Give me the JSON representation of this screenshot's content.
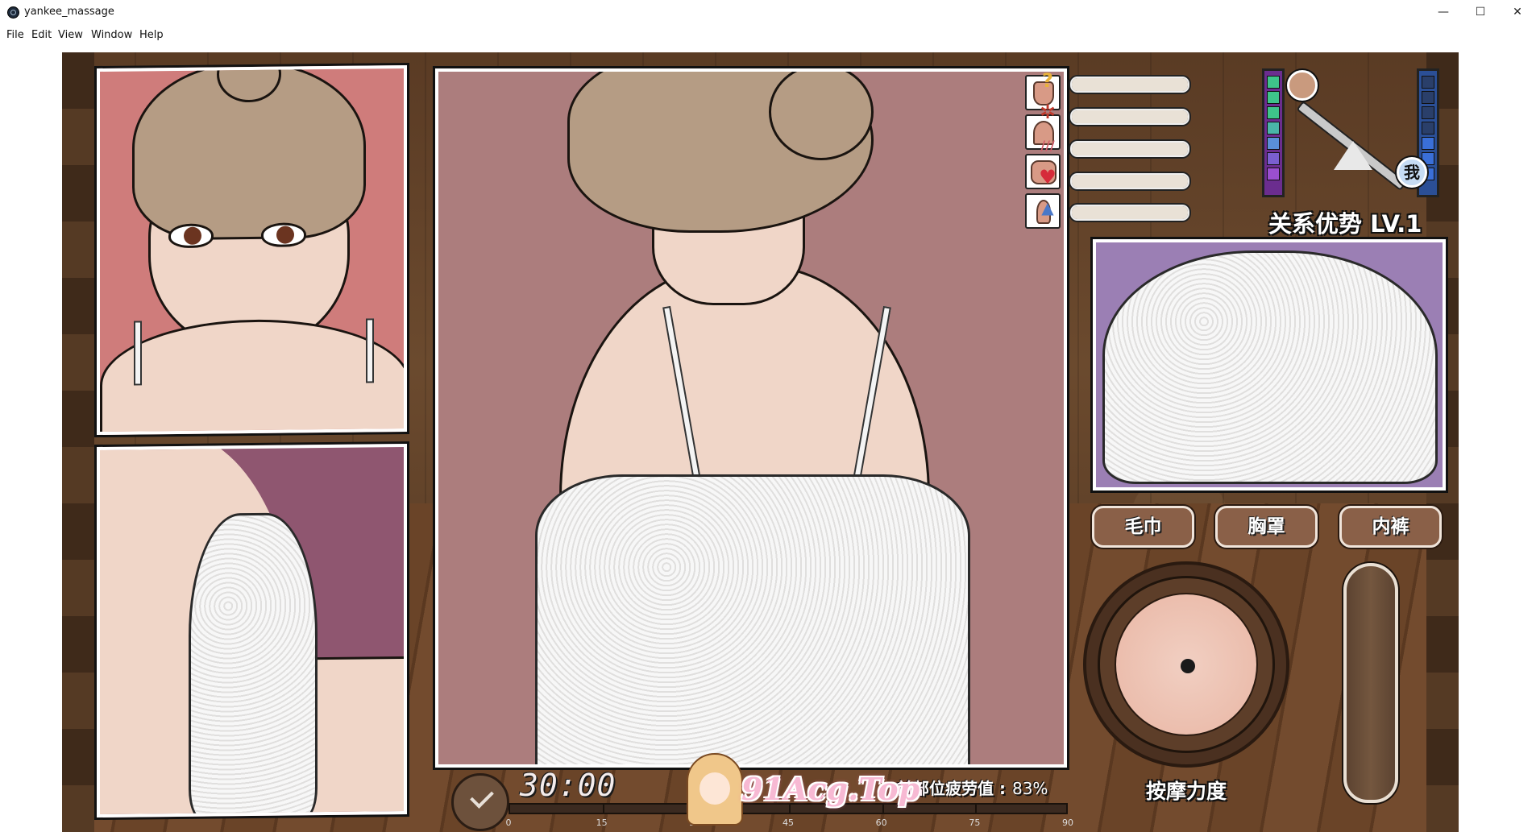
{
  "window": {
    "title": "yankee_massage",
    "minimize": "—",
    "maximize": "☐",
    "close": "✕"
  },
  "menu": [
    "File",
    "Edit",
    "View",
    "Window",
    "Help"
  ],
  "hud": {
    "timer": "30:00",
    "fatigue_label": "前部位疲劳值 :",
    "fatigue_value": "83%",
    "fatigue_fraction": 0.83,
    "progress_ticks": [
      "0",
      "15",
      "30",
      "45",
      "60",
      "75",
      "90"
    ],
    "relation": "关系优势 LV.1",
    "me_label": "我",
    "strength_label": "按摩力度",
    "watermark": "91Acg.Top"
  },
  "stats": [
    {
      "icon": "question-icon",
      "glyph": "?",
      "color": "#e8b23a",
      "fill": 1.0
    },
    {
      "icon": "anger-icon",
      "glyph": "✲",
      "color": "#c0392b",
      "fill": 1.0
    },
    {
      "icon": "blush-icon",
      "glyph": "///",
      "color": "#d35c6a",
      "fill": 1.0
    },
    {
      "icon": "heart-icon",
      "glyph": "♥",
      "color": "#d62b3a",
      "fill": 1.0
    },
    {
      "icon": "thumbs-up-icon",
      "glyph": "👍",
      "color": "#4a78c8",
      "fill": 1.0
    }
  ],
  "tools": [
    {
      "name": "hand-tool-icon"
    },
    {
      "name": "cone-tool-icon"
    },
    {
      "name": "roller-tool-icon"
    },
    {
      "name": "finger-tool-icon"
    }
  ],
  "clothes": [
    {
      "name": "towel-button",
      "label": "毛巾"
    },
    {
      "name": "bra-button",
      "label": "胸罩"
    },
    {
      "name": "panties-button",
      "label": "内裤"
    }
  ],
  "colors": {
    "green_meter": "#3ec48a",
    "blue_meter": "#3a6fd8",
    "purple_meter": "#9a4fd0"
  }
}
